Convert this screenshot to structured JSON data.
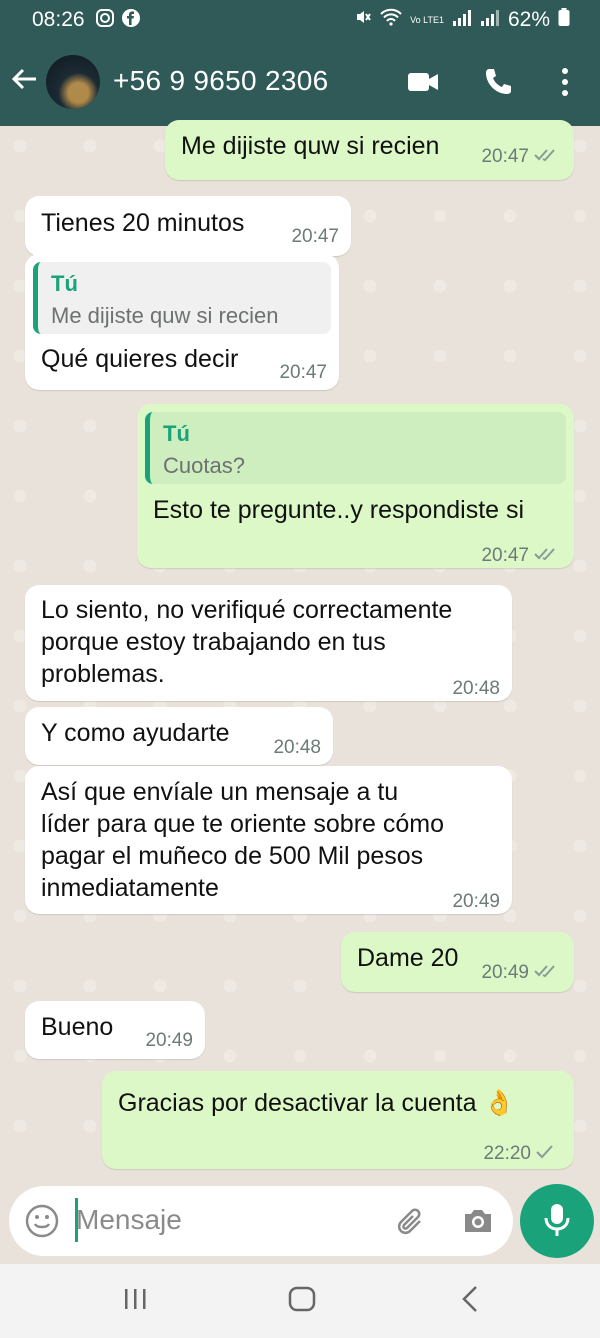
{
  "status_bar": {
    "time": "08:26",
    "battery": "62%",
    "network_label": "Vo LTE1"
  },
  "header": {
    "contact": "+56 9 9650 2306",
    "back_icon": "arrow-left-icon",
    "video_icon": "video-call-icon",
    "call_icon": "phone-icon",
    "menu_icon": "more-vert-icon"
  },
  "messages": [
    {
      "dir": "out",
      "text": "Me dijiste quw si recien",
      "time": "20:47",
      "ticks": "double"
    },
    {
      "dir": "in",
      "text": "Tienes 20 minutos",
      "time": "20:47"
    },
    {
      "dir": "in",
      "quote_name": "Tú",
      "quote_text": "Me dijiste quw si recien",
      "text": "Qué quieres decir",
      "time": "20:47"
    },
    {
      "dir": "out",
      "quote_name": "Tú",
      "quote_text": "Cuotas?",
      "text": "Esto te pregunte..y respondiste si",
      "time": "20:47",
      "ticks": "double"
    },
    {
      "dir": "in",
      "lines": [
        "Lo siento, no verifiqué correctamente",
        "porque estoy trabajando en tus",
        "problemas."
      ],
      "time": "20:48"
    },
    {
      "dir": "in",
      "text": "Y como ayudarte",
      "time": "20:48"
    },
    {
      "dir": "in",
      "lines": [
        "Así que envíale un mensaje a tu",
        "líder para que te oriente sobre cómo",
        "pagar el muñeco de 500 Mil pesos",
        "inmediatamente"
      ],
      "time": "20:49"
    },
    {
      "dir": "out",
      "text": "Dame 20",
      "time": "20:49",
      "ticks": "double"
    },
    {
      "dir": "in",
      "text": "Bueno",
      "time": "20:49"
    },
    {
      "dir": "out",
      "text": "Gracias por desactivar la cuenta 👌",
      "time": "22:20",
      "ticks": "single"
    }
  ],
  "composer": {
    "placeholder": "Mensaje",
    "emoji_icon": "emoji-icon",
    "attach_icon": "paperclip-icon",
    "camera_icon": "camera-icon",
    "mic_icon": "microphone-icon"
  },
  "colors": {
    "header": "#2f5a57",
    "outgoing": "#dcf8c6",
    "incoming": "#ffffff",
    "accent": "#1aa37a"
  }
}
